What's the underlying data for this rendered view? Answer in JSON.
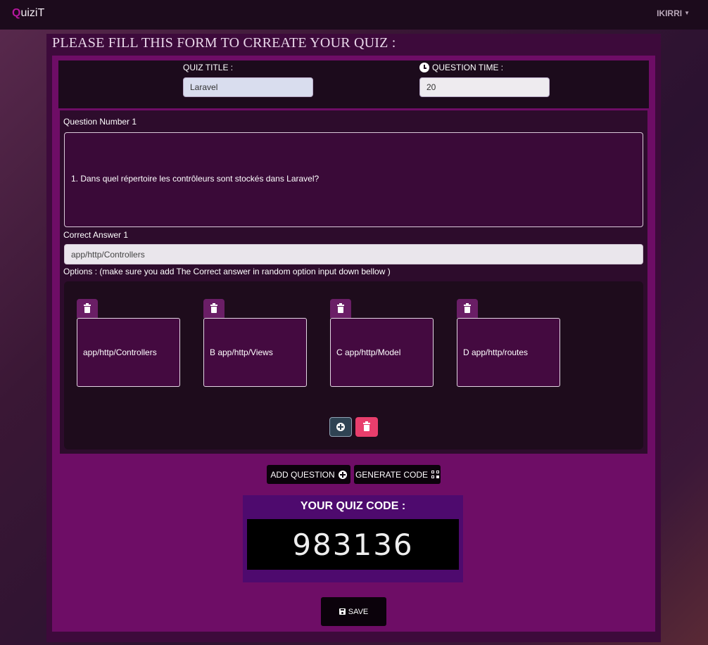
{
  "navbar": {
    "brand_first": "Q",
    "brand_rest": "uiziT",
    "user": "IKIRRI"
  },
  "page": {
    "title": "PLEASE FILL THIS FORM TO CRREATE YOUR QUIZ :"
  },
  "quiz": {
    "title_label": "QUIZ TITLE :",
    "title_value": "Laravel",
    "time_label": "QUESTION TIME :",
    "time_value": "20"
  },
  "question": {
    "label": "Question Number 1",
    "text": "1. Dans quel répertoire les contrôleurs sont stockés dans Laravel?",
    "answer_label": "Correct Answer 1",
    "answer_value": "app/http/Controllers",
    "options_label": "Options : (make sure you add The Correct answer in random option input down bellow )",
    "options": [
      {
        "text": "app/http/Controllers"
      },
      {
        "text": "B app/http/Views"
      },
      {
        "text": "C app/http/Model"
      },
      {
        "text": "D app/http/routes"
      }
    ]
  },
  "actions": {
    "add_question": "ADD QUESTION",
    "generate_code": "GENERATE CODE",
    "save": "SAVE"
  },
  "code": {
    "title": "YOUR QUIZ CODE :",
    "value": "983136"
  },
  "icons": {
    "clock": "clock-icon",
    "trash": "trash-icon",
    "plus": "plus-circle-icon",
    "qr": "qrcode-icon",
    "save": "floppy-icon"
  },
  "colors": {
    "navbar": "#1c0b1c",
    "form_panel": "#6e0d66",
    "code_box": "#4e0a6e",
    "delete_button": "#e83e6c",
    "add_button": "#2f4353"
  }
}
